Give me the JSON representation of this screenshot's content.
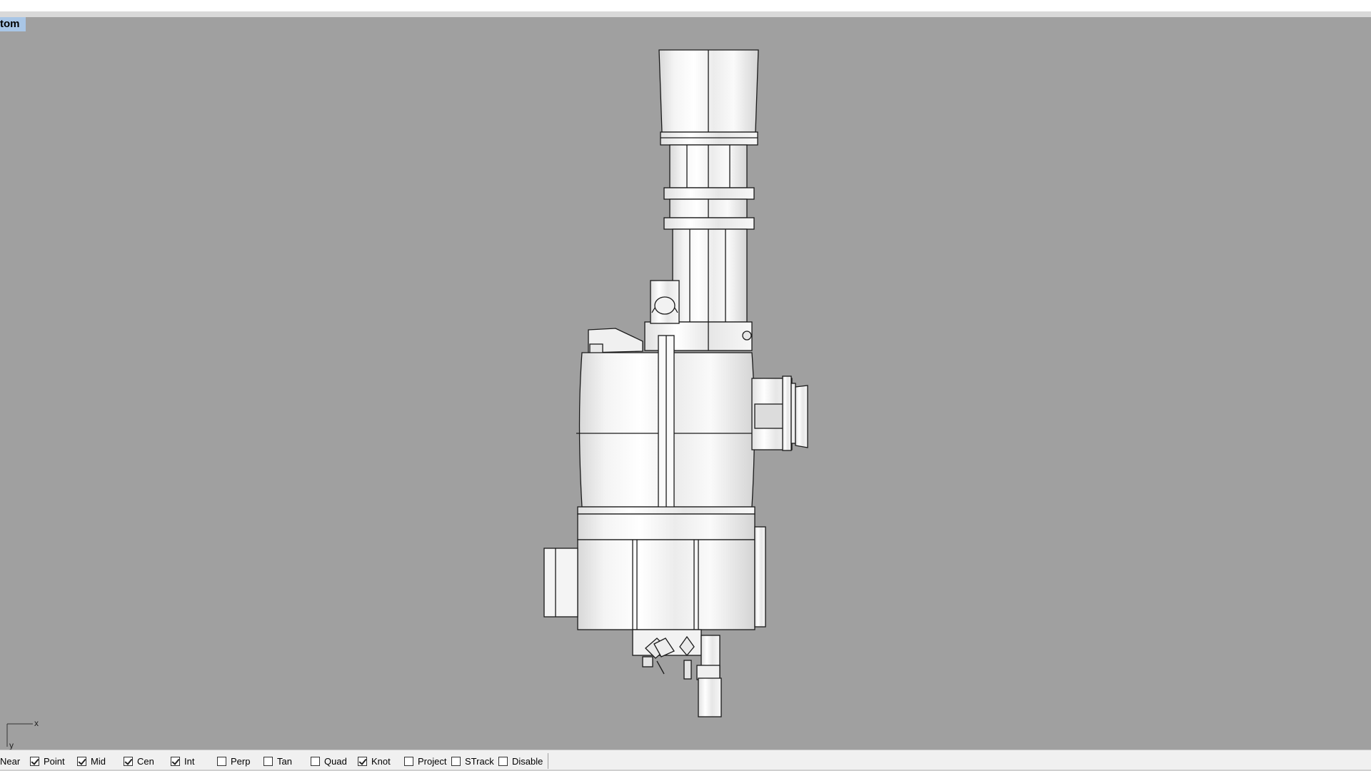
{
  "viewport": {
    "title": "tom",
    "background": "#a0a0a0",
    "axis": {
      "x_label": "x",
      "y_label": "y"
    }
  },
  "statusbar": {
    "osnaps": [
      {
        "label": "Near",
        "checked": true
      },
      {
        "label": "Point",
        "checked": true
      },
      {
        "label": "Mid",
        "checked": true
      },
      {
        "label": "Cen",
        "checked": true
      },
      {
        "label": "Int",
        "checked": true
      },
      {
        "label": "Perp",
        "checked": false
      },
      {
        "label": "Tan",
        "checked": false
      },
      {
        "label": "Quad",
        "checked": false
      },
      {
        "label": "Knot",
        "checked": true
      },
      {
        "label": "Project",
        "checked": false
      },
      {
        "label": "STrack",
        "checked": false
      },
      {
        "label": "Disable",
        "checked": false
      }
    ]
  }
}
